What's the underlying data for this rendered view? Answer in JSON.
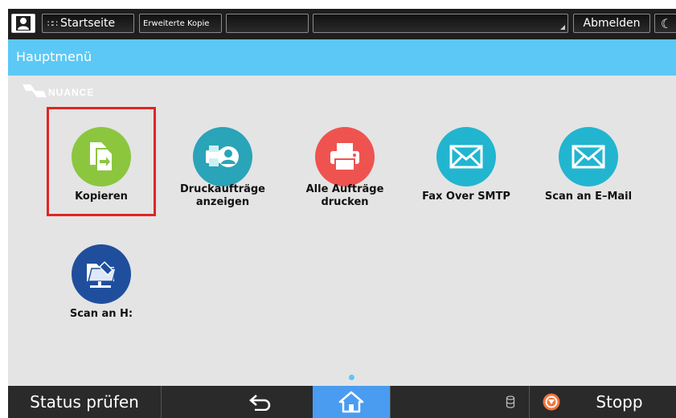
{
  "topbar": {
    "user_icon": "user-icon",
    "home_label": "Startseite",
    "home_icon": "apps-grid-icon",
    "app_label": "Erweiterte Kopie",
    "logout_label": "Abmelden",
    "energy_icon": "moon-icon"
  },
  "titlebar": {
    "title": "Hauptmenü"
  },
  "logo": {
    "brand": "NUANCE"
  },
  "apps": [
    {
      "label": "Kopieren",
      "icon": "copy-icon",
      "color": "#8cc63f",
      "selected": true
    },
    {
      "label_line1": "Druckaufträge",
      "label_line2": "anzeigen",
      "icon": "print-jobs-icon",
      "color": "#2aa4b8"
    },
    {
      "label_line1": "Alle Aufträge",
      "label_line2": "drucken",
      "icon": "printer-icon",
      "color": "#ef5350"
    },
    {
      "label": "Fax Over SMTP",
      "icon": "envelope-icon",
      "color": "#22b5d0"
    },
    {
      "label": "Scan an E–Mail",
      "icon": "envelope-icon",
      "color": "#22b5d0"
    },
    {
      "label": "Scan an H:",
      "icon": "scan-folder-icon",
      "color": "#1f4f9c"
    }
  ],
  "bottombar": {
    "status_label": "Status prüfen",
    "back_icon": "back-icon",
    "home_icon": "home-icon",
    "data_icon": "data-indicator-icon",
    "stop_icon": "stop-icon",
    "stop_label": "Stopp",
    "accent": "#4a9cf0"
  },
  "colors": {
    "title_bar": "#5bc8f5",
    "selection_border": "#e02525",
    "background": "#e4e4e4"
  }
}
